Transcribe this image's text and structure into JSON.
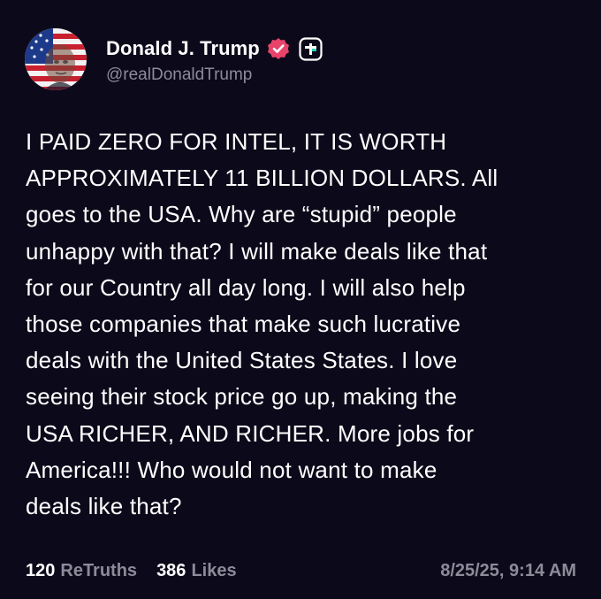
{
  "author": {
    "display_name": "Donald J. Trump",
    "handle": "@realDonaldTrump",
    "avatar_icon": "flag-portrait-avatar",
    "verified_icon": "verified-badge-icon",
    "plus_icon": "truth-plus-icon"
  },
  "post": {
    "lines": [
      "I PAID ZERO FOR INTEL, IT IS WORTH",
      "APPROXIMATELY 11 BILLION DOLLARS. All",
      "goes to the USA. Why are “stupid” people",
      "unhappy with that? I will make deals like that",
      "for our Country all day long. I will also help",
      "those companies that make such lucrative",
      "deals with the United States States. I love",
      "seeing their stock price go up, making the",
      "USA RICHER, AND RICHER. More jobs for",
      "America!!! Who would not want to make",
      "deals like that?"
    ]
  },
  "stats": {
    "retruths_count": "120",
    "retruths_label": "ReTruths",
    "likes_count": "386",
    "likes_label": "Likes",
    "timestamp": "8/25/25, 9:14 AM"
  },
  "colors": {
    "background": "#0c0a1a",
    "text": "#ffffff",
    "muted": "#8d8b99",
    "verified_pink": "#e8436b"
  }
}
